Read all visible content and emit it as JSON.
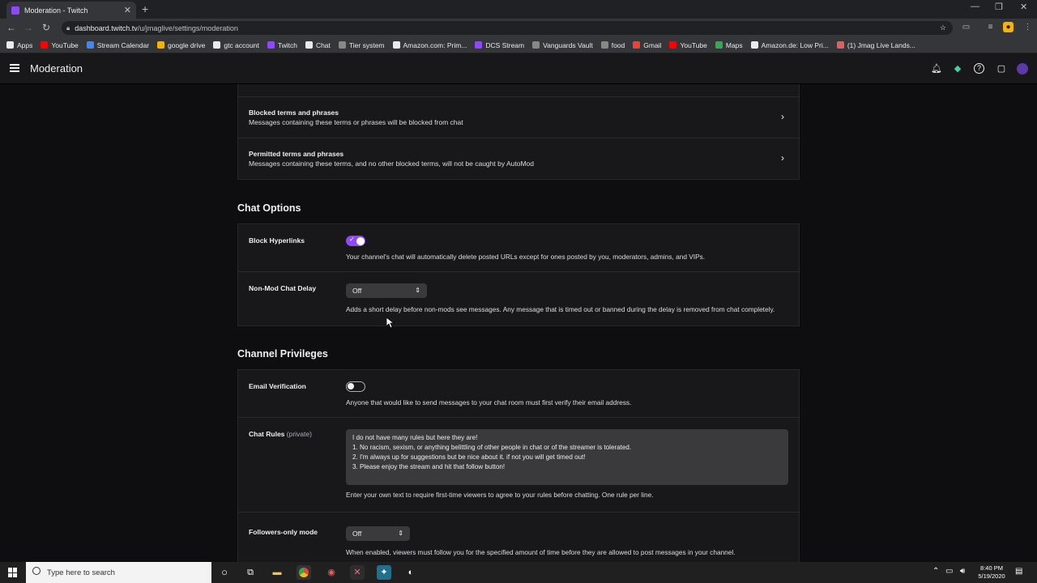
{
  "browser": {
    "tab_title": "Moderation - Twitch",
    "new_tab": "+",
    "close": "✕",
    "url_host": "dashboard.twitch.tv",
    "url_path": "/u/jmaglive/settings/moderation",
    "bookmarks": [
      {
        "label": "Apps",
        "color": "#e8eaed"
      },
      {
        "label": "YouTube",
        "color": "#ff0000"
      },
      {
        "label": "Stream Calendar",
        "color": "#4285f4"
      },
      {
        "label": "google drive",
        "color": "#f4b400"
      },
      {
        "label": "gtc account",
        "color": "#e8eaed"
      },
      {
        "label": "Twitch",
        "color": "#9147ff"
      },
      {
        "label": "Chat",
        "color": "#e8eaed"
      },
      {
        "label": "Tier system",
        "color": "#888888"
      },
      {
        "label": "Amazon.com: Prim...",
        "color": "#e8eaed"
      },
      {
        "label": "DCS Stream",
        "color": "#9147ff"
      },
      {
        "label": "Vanguards Vault",
        "color": "#888888"
      },
      {
        "label": "food",
        "color": "#888888"
      },
      {
        "label": "Gmail",
        "color": "#ea4335"
      },
      {
        "label": "YouTube",
        "color": "#ff0000"
      },
      {
        "label": "Maps",
        "color": "#34a853"
      },
      {
        "label": "Amazon.de: Low Pri...",
        "color": "#e8eaed"
      },
      {
        "label": "(1) Jmag Live Lands...",
        "color": "#e06060"
      }
    ]
  },
  "header": {
    "title": "Moderation"
  },
  "automod_rows": [
    {
      "title": "Blocked terms and phrases",
      "desc": "Messages containing these terms or phrases will be blocked from chat"
    },
    {
      "title": "Permitted terms and phrases",
      "desc": "Messages containing these terms, and no other blocked terms, will not be caught by AutoMod"
    }
  ],
  "chat_options": {
    "heading": "Chat Options",
    "block_hyperlinks": {
      "label": "Block Hyperlinks",
      "enabled": true,
      "help": "Your channel's chat will automatically delete posted URLs except for ones posted by you, moderators, admins, and VIPs."
    },
    "non_mod_delay": {
      "label": "Non-Mod Chat Delay",
      "value": "Off",
      "help": "Adds a short delay before non-mods see messages. Any message that is timed out or banned during the delay is removed from chat completely."
    }
  },
  "channel_privileges": {
    "heading": "Channel Privileges",
    "email_verification": {
      "label": "Email Verification",
      "enabled": false,
      "help": "Anyone that would like to send messages to your chat room must first verify their email address."
    },
    "chat_rules": {
      "label": "Chat Rules",
      "private": "(private)",
      "lines": [
        "I do not have many rules but here they are!",
        "1. No racism, sexism, or anything belittling of other people in chat or of the streamer is tolerated.",
        "2. I'm always up for suggestions but be nice about it. if not you will get timed out!",
        "3. Please enjoy the stream and hit that follow button!"
      ],
      "help": "Enter your own text to require first-time viewers to agree to your rules before chatting. One rule per line."
    },
    "followers_only": {
      "label": "Followers-only mode",
      "value": "Off",
      "help": "When enabled, viewers must follow you for the specified amount of time before they are allowed to post messages in your channel."
    }
  },
  "taskbar": {
    "search_placeholder": "Type here to search",
    "time": "8:40 PM",
    "date": "5/19/2020"
  }
}
